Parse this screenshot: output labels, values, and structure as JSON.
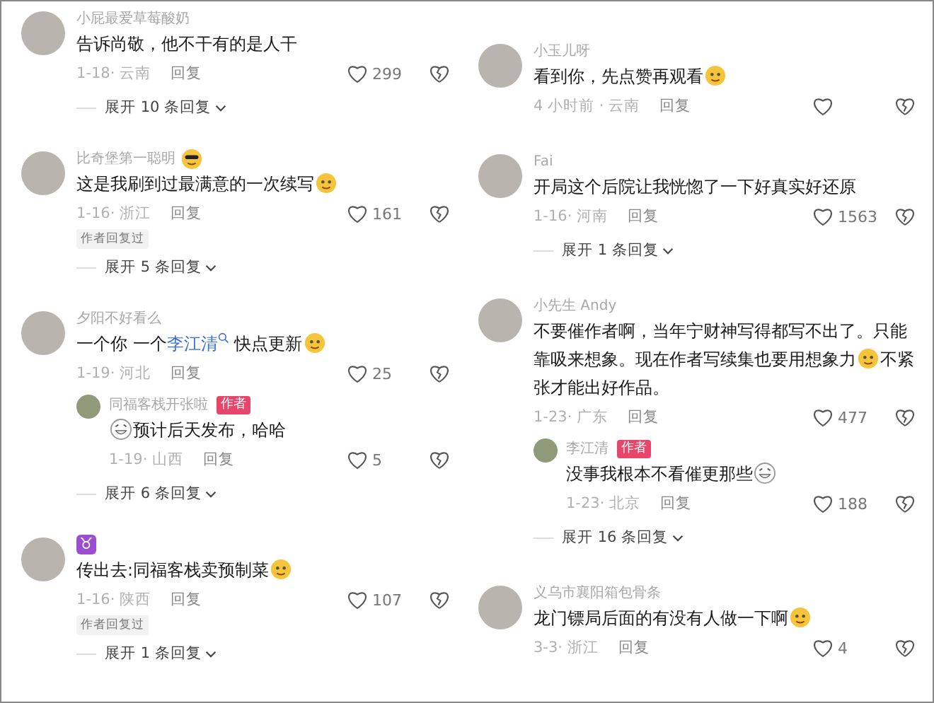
{
  "columns": [
    {
      "comments": [
        {
          "name": "小屁最爱草莓酸奶",
          "segments": [
            {
              "kind": "plain",
              "text": "告诉尚敬，他不干有的是人干"
            }
          ],
          "date": "1-18· 云南",
          "reply": "回复",
          "likes": "299",
          "expand": "展开 10 条回复"
        },
        {
          "name": "比奇堡第一聪明",
          "name_emoji": true,
          "segments": [
            {
              "kind": "plain",
              "text": "这是我刷到过最满意的一次续写"
            },
            {
              "kind": "emoji"
            }
          ],
          "date": "1-16· 浙江",
          "reply": "回复",
          "likes": "161",
          "tag": "作者回复过",
          "expand": "展开 5 条回复"
        },
        {
          "name": "夕阳不好看么",
          "segments": [
            {
              "kind": "plain",
              "text": "一个你 一个"
            },
            {
              "kind": "link",
              "text": "李江清"
            },
            {
              "kind": "plain",
              "text": " 快点更新"
            },
            {
              "kind": "emoji"
            }
          ],
          "date": "1-19· 河北",
          "reply": "回复",
          "likes": "25",
          "replies": [
            {
              "name": "同福客栈开张啦",
              "badge": "作者",
              "segments": [
                {
                  "kind": "emoji"
                },
                {
                  "kind": "plain",
                  "text": "预计后天发布，哈哈"
                }
              ],
              "date": "1-19· 山西",
              "reply": "回复",
              "likes": "5"
            }
          ],
          "expand": "展开 6 条回复"
        },
        {
          "name": "♉",
          "segments": [
            {
              "kind": "plain",
              "text": "传出去:同福客栈卖预制菜"
            },
            {
              "kind": "emoji"
            }
          ],
          "date": "1-16· 陕西",
          "reply": "回复",
          "likes": "107",
          "tag": "作者回复过",
          "expand": "展开 1 条回复"
        }
      ]
    },
    {
      "comments": [
        {
          "name": "小玉儿呀",
          "segments": [
            {
              "kind": "plain",
              "text": "看到你，先点赞再观看"
            },
            {
              "kind": "emoji"
            }
          ],
          "date": "4 小时前 · 云南",
          "reply": "回复"
        },
        {
          "name": "Fai",
          "segments": [
            {
              "kind": "plain",
              "text": "开局这个后院让我恍惚了一下好真实好还原"
            }
          ],
          "date": "1-16· 河南",
          "reply": "回复",
          "likes": "1563",
          "expand": "展开 1 条回复"
        },
        {
          "name": "小先生 Andy",
          "segments": [
            {
              "kind": "plain",
              "text": "不要催作者啊，当年宁财神写得都写不出了。只能靠吸来想象。现在作者写续集也要用想象力"
            },
            {
              "kind": "emoji"
            },
            {
              "kind": "plain",
              "text": "不紧张才能出好作品。"
            }
          ],
          "date": "1-23· 广东",
          "reply": "回复",
          "likes": "477",
          "replies": [
            {
              "name": "李江清",
              "badge": "作者",
              "segments": [
                {
                  "kind": "plain",
                  "text": "没事我根本不看催更那些"
                },
                {
                  "kind": "emoji"
                }
              ],
              "date": "1-23· 北京",
              "reply": "回复",
              "likes": "188"
            }
          ],
          "expand": "展开 16 条回复"
        },
        {
          "name": "义乌市襄阳箱包骨条",
          "segments": [
            {
              "kind": "plain",
              "text": "龙门镖局后面的有没有人做一下啊"
            },
            {
              "kind": "emoji"
            }
          ],
          "date": "3-3· 浙江",
          "reply": "回复",
          "likes": "4"
        }
      ]
    }
  ]
}
